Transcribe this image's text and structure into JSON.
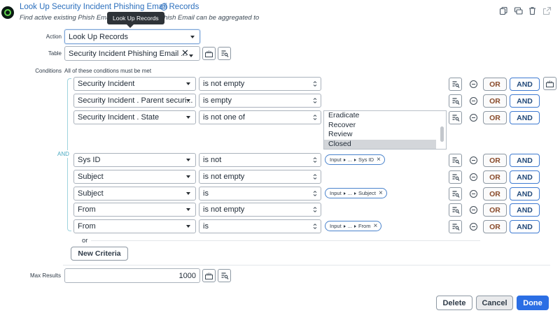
{
  "header": {
    "title": "Look Up Security Incident Phishing Email Records",
    "help_icon": "?",
    "subtitle_start": "Find active existing Phish Emails t",
    "subtitle_end": "Phish Email can be aggregated to",
    "tooltip": "Look Up Records"
  },
  "toolbar_icons": [
    "copy-icon",
    "comment-icon",
    "trash-icon",
    "external-link-icon"
  ],
  "form": {
    "action_label": "Action",
    "action_value": "Look Up Records",
    "table_label": "Table",
    "table_value": "Security Incident Phishing Email ...",
    "table_clear": "✕",
    "conditions_label": "Conditions",
    "conditions_hint": "All of these conditions must be met",
    "and_label": "AND",
    "or_label": "or",
    "new_criteria": "New Criteria",
    "max_results_label": "Max Results",
    "max_results_value": "1000"
  },
  "conditions": [
    {
      "field": "Security Incident",
      "operator": "is not empty"
    },
    {
      "field": "Security Incident . Parent securi...",
      "operator": "is empty"
    },
    {
      "field": "Security Incident . State",
      "operator": "is not one of"
    },
    {
      "field": "Sys ID",
      "operator": "is not",
      "pill": [
        "Input",
        "...",
        "Sys ID"
      ]
    },
    {
      "field": "Subject",
      "operator": "is not empty"
    },
    {
      "field": "Subject",
      "operator": "is",
      "pill": [
        "Input",
        "...",
        "Subject"
      ]
    },
    {
      "field": "From",
      "operator": "is not empty"
    },
    {
      "field": "From",
      "operator": "is",
      "pill": [
        "Input",
        "...",
        "From"
      ]
    }
  ],
  "state_options": [
    "Eradicate",
    "Recover",
    "Review",
    "Closed"
  ],
  "state_selected": "Closed",
  "row_buttons": {
    "or": "OR",
    "and": "AND"
  },
  "footer": {
    "delete": "Delete",
    "cancel": "Cancel",
    "done": "Done"
  },
  "colors": {
    "accent": "#2b6ee4",
    "link": "#2b6ee4",
    "or_text": "#8a4b2a",
    "and_border": "#3e7ad1"
  }
}
